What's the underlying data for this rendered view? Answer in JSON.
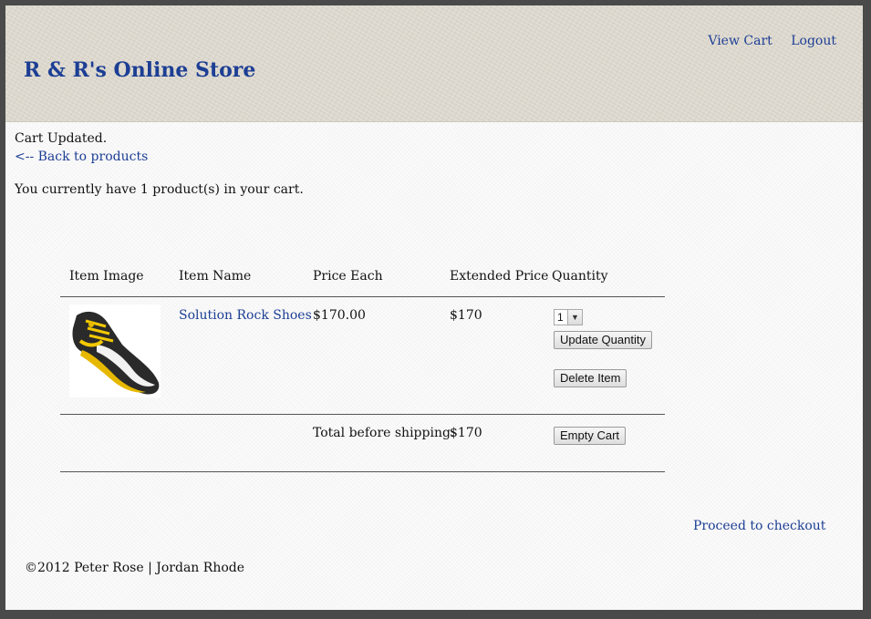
{
  "header": {
    "site_title": "R & R's Online Store",
    "nav": {
      "view_cart": "View Cart",
      "logout": "Logout"
    }
  },
  "status": {
    "message": "Cart Updated.",
    "back_link": "<-- Back to products",
    "cart_count_text": "You currently have 1 product(s) in your cart."
  },
  "cart": {
    "columns": [
      "Item Image",
      "Item Name",
      "Price Each",
      "Extended Price",
      "Quantity"
    ],
    "items": [
      {
        "image": "climbing-shoe-image",
        "name": "Solution Rock Shoes",
        "price_each": "$170.00",
        "extended_price": "$170",
        "quantity": "1",
        "update_label": "Update Quantity",
        "delete_label": "Delete Item"
      }
    ],
    "total_label": "Total before shipping:",
    "total_value": "$170",
    "empty_label": "Empty Cart"
  },
  "checkout_link": "Proceed to checkout",
  "footer": {
    "copyright": "©2012 Peter Rose | Jordan Rhode"
  },
  "colors": {
    "link": "#1c3e94",
    "header_bg": "#dcd7cd",
    "outer_frame": "#4a4a4a"
  }
}
